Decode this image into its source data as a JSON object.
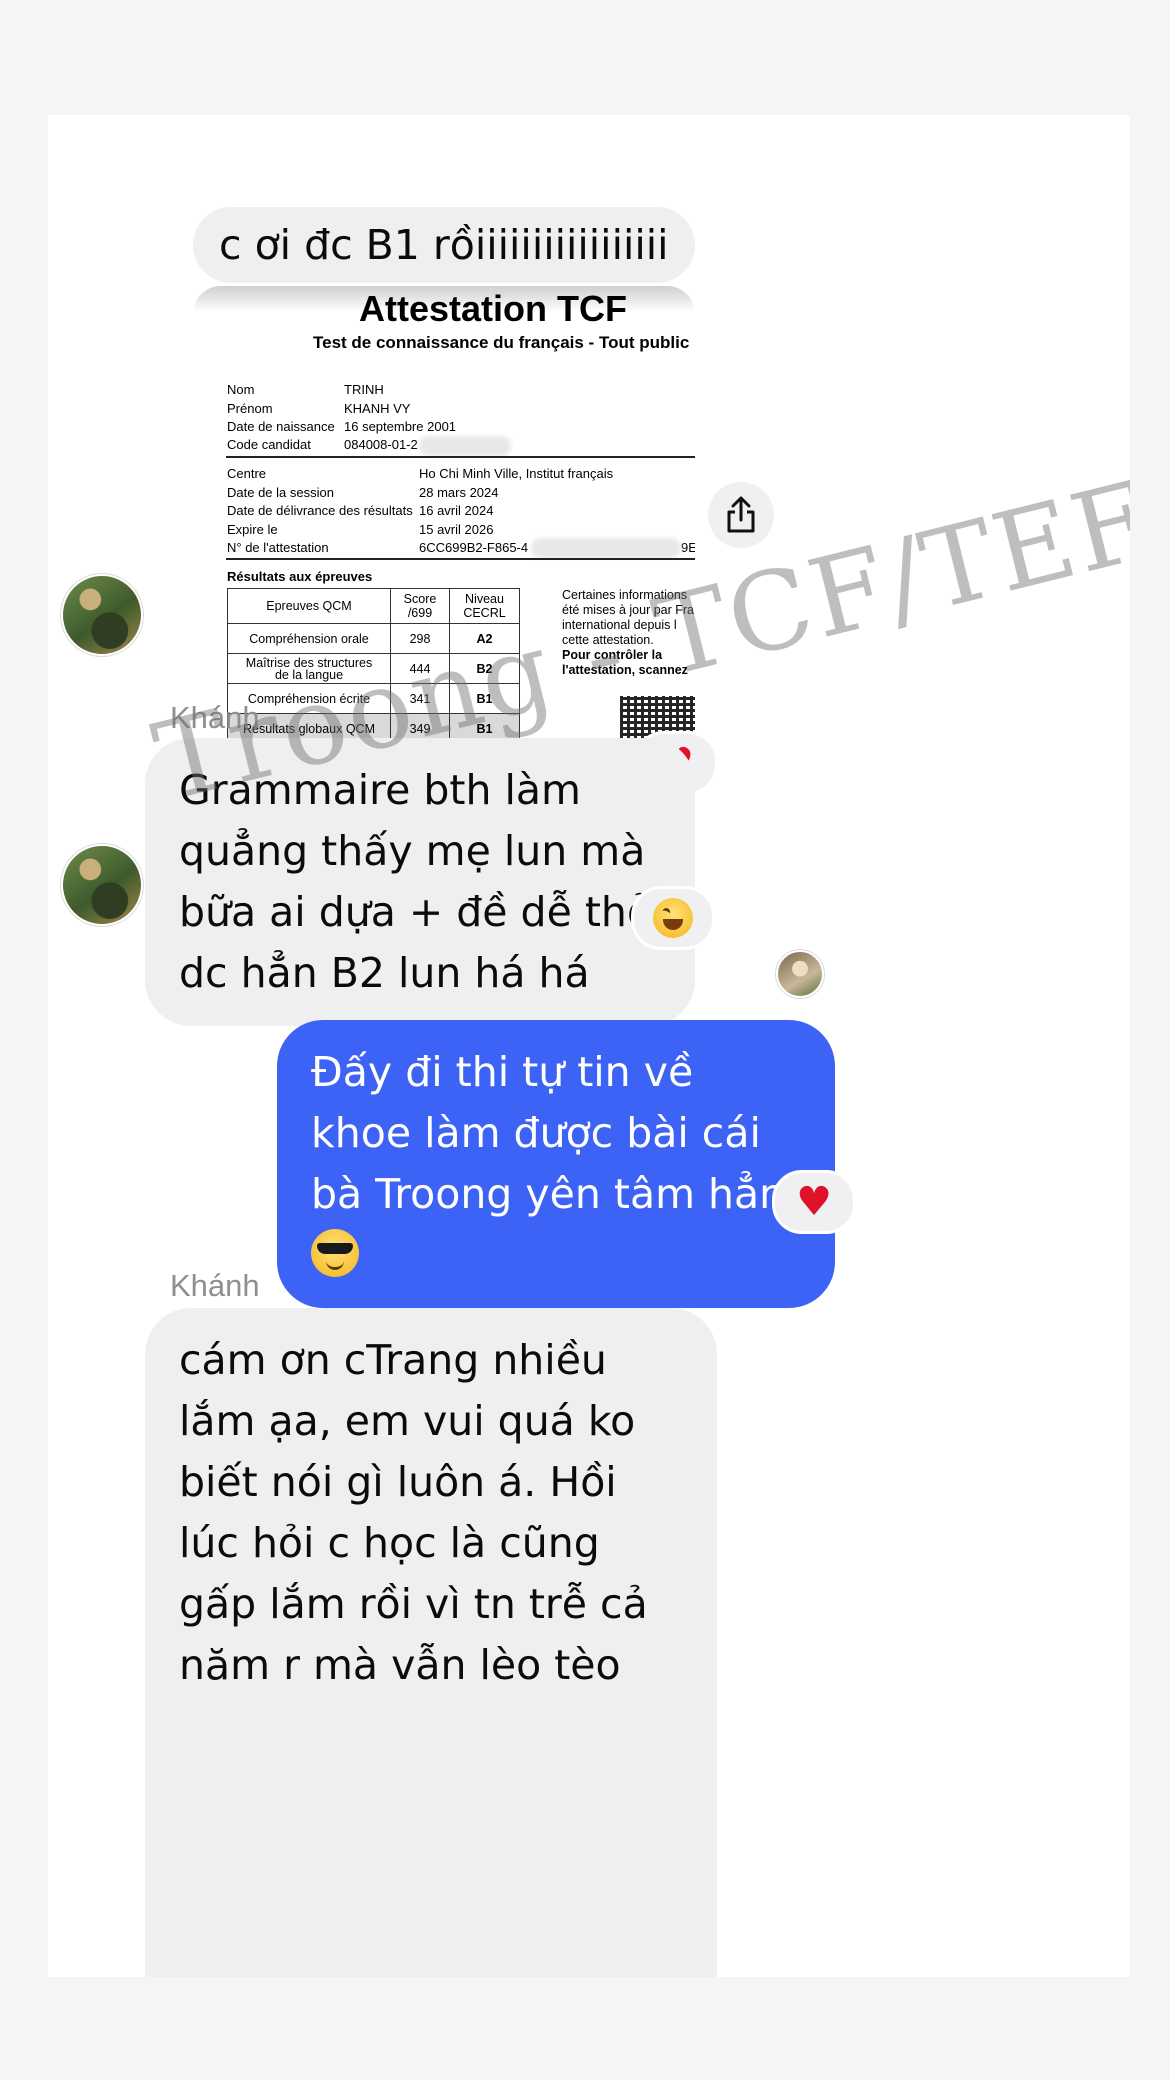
{
  "messages": {
    "m1": "c ơi đc B1 rồiiiiiiiiiiiiiiiii",
    "sender_1": "Khánh",
    "m2": "Grammaire bth làm quẳng thấy mẹ lun mà bữa ai dựa + đề dễ thở dc hẳn B2 lun há há",
    "m3_text": "Đấy đi thi tự tin về khoe làm được bài cái bà Troong yên tâm hẳn",
    "m3_emoji": "smiling-face-with-sunglasses",
    "sender_2": "Khánh",
    "m4": "cám ơn cTrang nhiều lắm ạa, em vui quá ko biết nói gì luôn á. Hồi lúc hỏi c học là cũng gấp lắm rồi vì tn trễ cả năm r mà vẫn lèo tèo"
  },
  "reactions": {
    "attestation": "heart",
    "m2": "grinning-squinting-face",
    "m3": "heart"
  },
  "attestation": {
    "title": "Attestation TCF",
    "subtitle": "Test de connaissance du français - Tout public",
    "nom_label": "Nom",
    "nom": "TRINH",
    "prenom_label": "Prénom",
    "prenom": "KHANH VY",
    "dob_label": "Date de naissance",
    "dob": "16 septembre 2001",
    "code_label": "Code candidat",
    "code": "084008-01-2",
    "centre_label": "Centre",
    "centre": "Ho Chi Minh Ville, Institut français",
    "session_label": "Date de la session",
    "session": "28 mars 2024",
    "delivery_label": "Date de délivrance des résultats",
    "delivery": "16 avril 2024",
    "expire_label": "Expire le",
    "expire": "15 avril 2026",
    "num_label": "N° de l'attestation",
    "num": "6CC699B2-F865-4",
    "num_end": "9E",
    "results_heading": "Résultats aux épreuves",
    "table": {
      "h1": "Epreuves QCM",
      "h2a": "Score",
      "h2b": "/699",
      "h3a": "Niveau",
      "h3b": "CECRL",
      "rows": [
        {
          "name_a": "Compréhension orale",
          "name_b": "",
          "score": "298",
          "level": "A2"
        },
        {
          "name_a": "Maîtrise des structures",
          "name_b": "de la langue",
          "score": "444",
          "level": "B2"
        },
        {
          "name_a": "Compréhension écrite",
          "name_b": "",
          "score": "341",
          "level": "B1"
        },
        {
          "name_a": "Résultats globaux QCM",
          "name_b": "",
          "score": "349",
          "level": "B1"
        }
      ]
    },
    "side_l1": "Certaines informations",
    "side_l2": "été mises à jour par Fra",
    "side_l3": "international    depuis l",
    "side_l4": "cette attestation.",
    "side_l5": "Pour    contrôler    la",
    "side_l6": "l'attestation, scannez"
  },
  "watermark": "Troong - TCF/TEF",
  "icons": {
    "share": "share-icon"
  },
  "colors": {
    "outgoing_bubble": "#3d63f6",
    "incoming_bubble": "#efeff0",
    "heart": "#e0112b"
  }
}
